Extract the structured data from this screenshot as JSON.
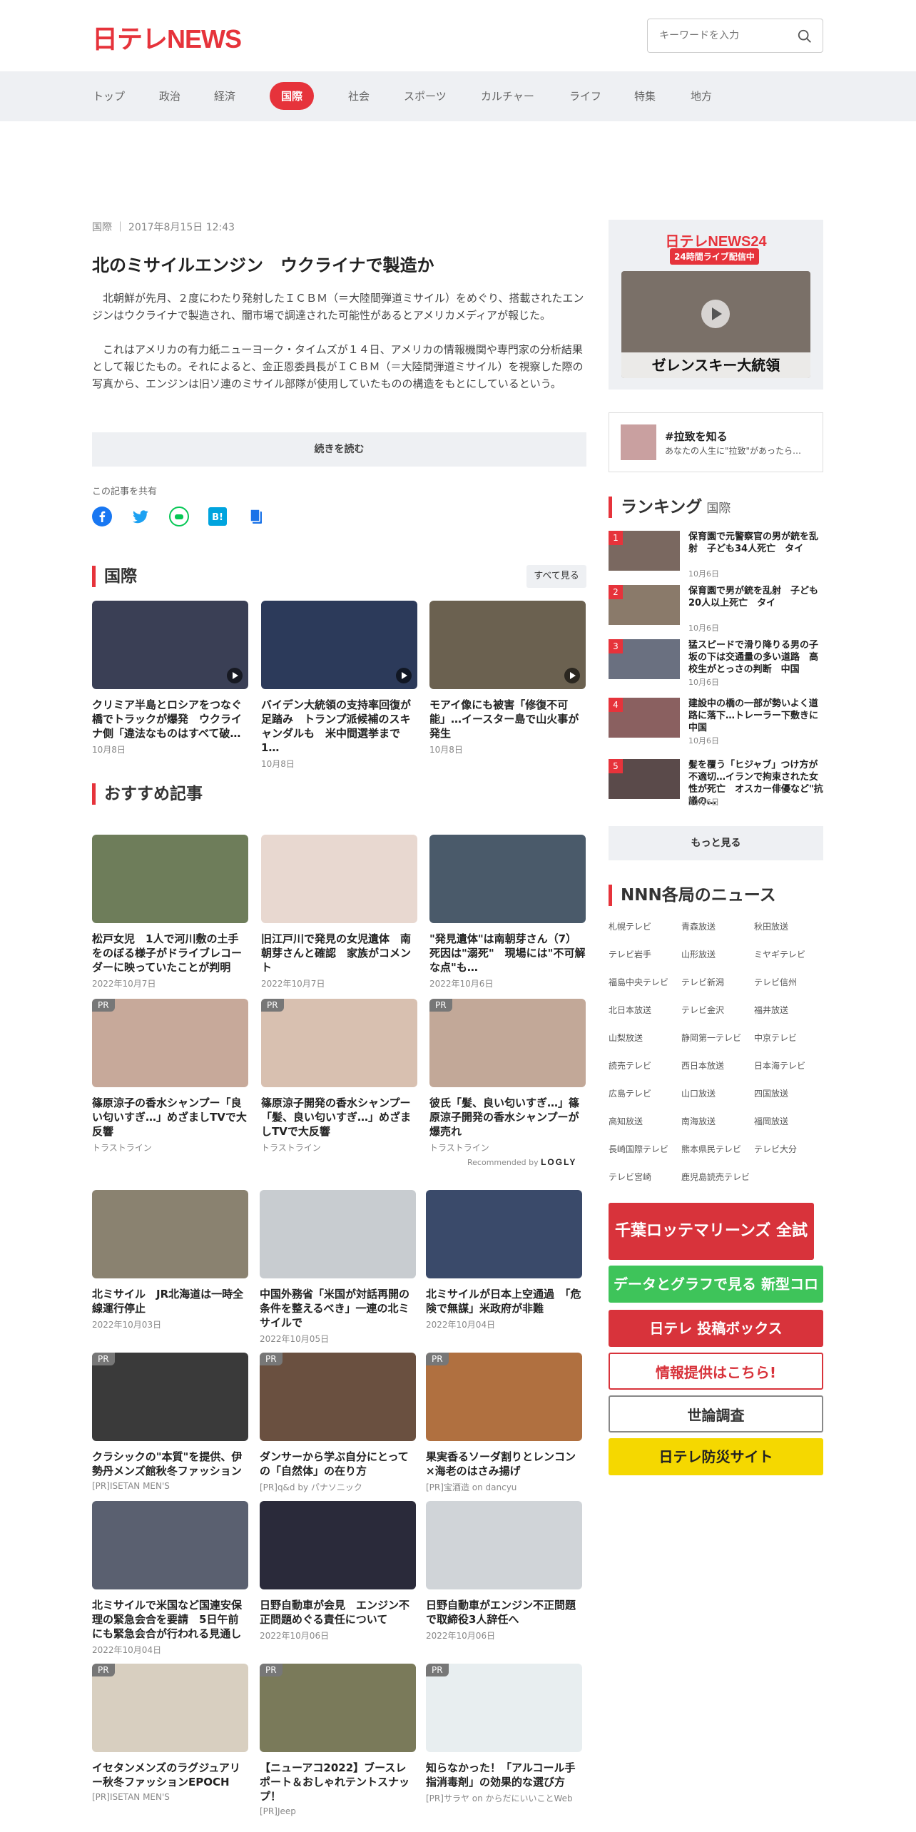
{
  "header": {
    "logo": "日テレNEWS",
    "search_placeholder": "キーワードを入力"
  },
  "nav": [
    "トップ",
    "政治",
    "経済",
    "国際",
    "社会",
    "スポーツ",
    "カルチャー",
    "ライフ",
    "特集",
    "地方"
  ],
  "nav_active": "国際",
  "article": {
    "category": "国際",
    "date": "2017年8月15日 12:43",
    "title": "北のミサイルエンジン　ウクライナで製造か",
    "p1": "　北朝鮮が先月、２度にわたり発射したＩＣＢＭ（＝大陸間弾道ミサイル）をめぐり、搭載されたエンジンはウクライナで製造され、闇市場で調達された可能性があるとアメリカメディアが報じた。",
    "p2": "　これはアメリカの有力紙ニューヨーク・タイムズが１４日、アメリカの情報機関や専門家の分析結果として報じたもの。それによると、金正恩委員長がＩＣＢＭ（＝大陸間弾道ミサイル）を視察した際の写真から、エンジンは旧ソ連のミサイル部隊が使用していたものの構造をもとにしているという。",
    "read_more": "続きを読む",
    "share_label": "この記事を共有"
  },
  "kokusai": {
    "heading": "国際",
    "more": "すべて見る",
    "items": [
      {
        "title": "クリミア半島とロシアをつなぐ橋でトラックが爆発　ウクライナ側「違法なものはすべて破…",
        "date": "10月8日",
        "color": "#3a3f55"
      },
      {
        "title": "バイデン大統領の支持率回復が足踏み　トランプ派候補のスキャンダルも　米中間選挙まで1…",
        "date": "10月8日",
        "color": "#2c3a5a"
      },
      {
        "title": "モアイ像にも被害「修復不可能」…イースター島で山火事が発生",
        "date": "10月8日",
        "color": "#6b6150"
      }
    ]
  },
  "osusume": {
    "heading": "おすすめ記事",
    "items": [
      {
        "title": "松戸女児　1人で河川敷の土手をのぼる様子がドライブレコーダーに映っていたことが判明",
        "date": "2022年10月7日",
        "pr": "",
        "color": "#6e7d5a"
      },
      {
        "title": "旧江戸川で発見の女児遺体　南朝芽さんと確認　家族がコメント",
        "date": "2022年10月7日",
        "pr": "",
        "color": "#e8d8d0"
      },
      {
        "title": "\"発見遺体\"は南朝芽さん（7）死因は\"溺死\"　現場には\"不可解な点\"も…",
        "date": "2022年10月6日",
        "pr": "",
        "color": "#4a5a6a"
      },
      {
        "title": "篠原涼子の香水シャンプー「良い匂いすぎ…」めざましTVで大反響",
        "date": "トラストライン",
        "pr": "PR",
        "color": "#c7a99a"
      },
      {
        "title": "篠原涼子開発の香水シャンプー「髪、良い匂いすぎ…」めざましTVで大反響",
        "date": "トラストライン",
        "pr": "PR",
        "color": "#d8c0b0"
      },
      {
        "title": "彼氏「髪、良い匂いすぎ…」篠原涼子開発の香水シャンプーが爆売れ",
        "date": "トラストライン",
        "pr": "PR",
        "color": "#c2a898"
      }
    ],
    "recommended": "Recommended by",
    "logo": "LOGLY"
  },
  "grid": [
    {
      "title": "北ミサイル　JR北海道は一時全線運行停止",
      "date": "2022年10月03日",
      "pr": "",
      "color": "#8a8270"
    },
    {
      "title": "中国外務省「米国が対話再開の条件を整えるべき」一連の北ミサイルで",
      "date": "2022年10月05日",
      "pr": "",
      "color": "#c8ccd0"
    },
    {
      "title": "北ミサイルが日本上空通過　「危険で無謀」米政府が非難",
      "date": "2022年10月04日",
      "pr": "",
      "color": "#3a4a6a"
    },
    {
      "title": "クラシックの\"本質\"を提供、伊勢丹メンズ館秋冬ファッション",
      "date": "[PR]ISETAN MEN'S",
      "pr": "PR",
      "color": "#3a3a3a"
    },
    {
      "title": "ダンサーから学ぶ自分にとっての「自然体」の在り方",
      "date": "[PR]q&d by パナソニック",
      "pr": "PR",
      "color": "#6a5040"
    },
    {
      "title": "果実香るソーダ割りとレンコン×海老のはさみ揚げ",
      "date": "[PR]宝酒造 on dancyu",
      "pr": "PR",
      "color": "#b07040"
    },
    {
      "title": "北ミサイルで米国など国連安保理の緊急会合を要請　5日午前にも緊急会合が行われる見通し",
      "date": "2022年10月04日",
      "pr": "",
      "color": "#5a6070"
    },
    {
      "title": "日野自動車が会見　エンジン不正問題めぐる責任について",
      "date": "2022年10月06日",
      "pr": "",
      "color": "#2a2a3a"
    },
    {
      "title": "日野自動車がエンジン不正問題で取締役3人辞任へ",
      "date": "2022年10月06日",
      "pr": "",
      "color": "#d0d4d8"
    },
    {
      "title": "イセタンメンズのラグジュアリー秋冬ファッションEPOCH",
      "date": "[PR]ISETAN MEN'S",
      "pr": "PR",
      "color": "#d8cfc0"
    },
    {
      "title": "【ニューアコ2022】ブースレポート＆おしゃれテントスナップ！",
      "date": "[PR]Jeep",
      "pr": "PR",
      "color": "#7a7a5a"
    },
    {
      "title": "知らなかった！「アルコール手指消毒剤」の効果的な選び方",
      "date": "[PR]サラヤ on からだにいいことWeb",
      "pr": "PR",
      "color": "#e8eef0"
    }
  ],
  "sidebar": {
    "live_title": "日テレNEWS24",
    "live_badge": "24時間ライブ配信中",
    "live_caption": "ゼレンスキー大統領",
    "rachi_title": "#拉致を知る",
    "rachi_sub": "あなたの人生に\"拉致\"があったら…",
    "ranking_heading": "ランキング",
    "ranking_sub": "国際",
    "ranking": [
      {
        "n": "1",
        "title": "保育園で元警察官の男が銃を乱射　子ども34人死亡　タイ",
        "date": "10月6日",
        "color": "#7a6860"
      },
      {
        "n": "2",
        "title": "保育園で男が銃を乱射　子ども20人以上死亡　タイ",
        "date": "10月6日",
        "color": "#8a7a6a"
      },
      {
        "n": "3",
        "title": "猛スピードで滑り降りる男の子　坂の下は交通量の多い道路　高校生がとっさの判断　中国",
        "date": "10月6日",
        "color": "#6a7080"
      },
      {
        "n": "4",
        "title": "建設中の橋の一部が勢いよく道路に落下…トレーラー下敷きに　中国",
        "date": "10月6日",
        "color": "#8a6060"
      },
      {
        "n": "5",
        "title": "髪を覆う「ヒジャブ」つけ方が不適切…イランで拘束された女性が死亡　オスカー俳優など\"抗議の…",
        "date": "10月6日",
        "color": "#5a4a4a"
      }
    ],
    "more": "もっと見る",
    "nnn_heading": "NNN各局のニュース",
    "affiliates": [
      "札幌テレビ",
      "青森放送",
      "秋田放送",
      "テレビ岩手",
      "山形放送",
      "ミヤギテレビ",
      "福島中央テレビ",
      "テレビ新潟",
      "テレビ信州",
      "北日本放送",
      "テレビ金沢",
      "福井放送",
      "山梨放送",
      "静岡第一テレビ",
      "中京テレビ",
      "読売テレビ",
      "西日本放送",
      "日本海テレビ",
      "広島テレビ",
      "山口放送",
      "四国放送",
      "高知放送",
      "南海放送",
      "福岡放送",
      "長崎国際テレビ",
      "熊本県民テレビ",
      "テレビ大分",
      "テレビ宮崎",
      "鹿児島読売テレビ"
    ],
    "banners": [
      {
        "text": "千葉ロッテマリーンズ 全試合生中継!",
        "bg": "#d8333b",
        "fg": "#ffffff"
      },
      {
        "text": "データとグラフで見る 新型コロナウイルス",
        "bg": "#3ec45a",
        "fg": "#ffffff"
      },
      {
        "text": "日テレ 投稿ボックス",
        "bg": "#d8333b",
        "fg": "#ffffff"
      },
      {
        "text": "情報提供はこちら!",
        "bg": "#ffffff",
        "fg": "#d8333b"
      },
      {
        "text": "世論調査",
        "bg": "#ffffff",
        "fg": "#333333"
      },
      {
        "text": "日テレ防災サイト",
        "bg": "#f5d800",
        "fg": "#222222"
      }
    ]
  },
  "colors": {
    "accent": "#e6333b",
    "nav_bg": "#eef0f3"
  }
}
